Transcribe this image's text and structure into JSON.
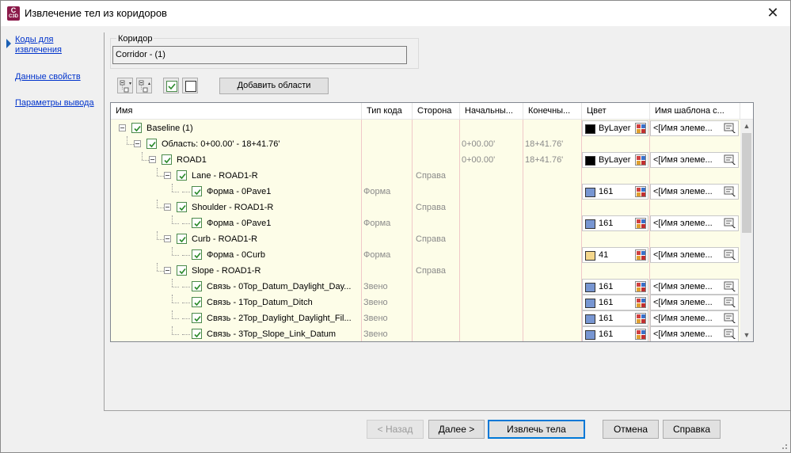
{
  "window": {
    "title": "Извлечение тел из коридоров",
    "icon_text": "C",
    "icon_sub": "C3D",
    "close_glyph": "✕"
  },
  "nav": {
    "items": [
      {
        "label": "Коды для извлечения"
      },
      {
        "label": "Данные свойств"
      },
      {
        "label": "Параметры вывода"
      }
    ]
  },
  "corridor": {
    "group_label": "Коридор",
    "value": "Corridor - (1)"
  },
  "toolbar": {
    "add_areas_label": "Добавить области"
  },
  "grid": {
    "columns": [
      "Имя",
      "Тип кода",
      "Сторона",
      "Начальны...",
      "Конечны...",
      "Цвет",
      "Имя шаблона с..."
    ],
    "rows": [
      {
        "name": "Baseline (1)",
        "code_type": "",
        "side": "",
        "start": "",
        "end": "",
        "color": "ByLayer",
        "color_hex": "#000000",
        "template": "<[Имя элеме..."
      },
      {
        "name": "Область: 0+00.00' - 18+41.76'",
        "code_type": "",
        "side": "",
        "start": "0+00.00'",
        "end": "18+41.76'",
        "color": "",
        "color_hex": "",
        "template": ""
      },
      {
        "name": "ROAD1",
        "code_type": "",
        "side": "",
        "start": "0+00.00'",
        "end": "18+41.76'",
        "color": "ByLayer",
        "color_hex": "#000000",
        "template": "<[Имя элеме..."
      },
      {
        "name": "Lane - ROAD1-R",
        "code_type": "",
        "side": "Справа",
        "start": "",
        "end": "",
        "color": "",
        "color_hex": "",
        "template": ""
      },
      {
        "name": "Форма - 0Pave1",
        "code_type": "Форма",
        "side": "",
        "start": "",
        "end": "",
        "color": "161",
        "color_hex": "#7896d2",
        "template": "<[Имя элеме..."
      },
      {
        "name": "Shoulder - ROAD1-R",
        "code_type": "",
        "side": "Справа",
        "start": "",
        "end": "",
        "color": "",
        "color_hex": "",
        "template": ""
      },
      {
        "name": "Форма - 0Pave1",
        "code_type": "Форма",
        "side": "",
        "start": "",
        "end": "",
        "color": "161",
        "color_hex": "#7896d2",
        "template": "<[Имя элеме..."
      },
      {
        "name": "Curb - ROAD1-R",
        "code_type": "",
        "side": "Справа",
        "start": "",
        "end": "",
        "color": "",
        "color_hex": "",
        "template": ""
      },
      {
        "name": "Форма - 0Curb",
        "code_type": "Форма",
        "side": "",
        "start": "",
        "end": "",
        "color": "41",
        "color_hex": "#f5d78c",
        "template": "<[Имя элеме..."
      },
      {
        "name": "Slope - ROAD1-R",
        "code_type": "",
        "side": "Справа",
        "start": "",
        "end": "",
        "color": "",
        "color_hex": "",
        "template": ""
      },
      {
        "name": "Связь - 0Top_Datum_Daylight_Day...",
        "code_type": "Звено",
        "side": "",
        "start": "",
        "end": "",
        "color": "161",
        "color_hex": "#7896d2",
        "template": "<[Имя элеме..."
      },
      {
        "name": "Связь - 1Top_Datum_Ditch",
        "code_type": "Звено",
        "side": "",
        "start": "",
        "end": "",
        "color": "161",
        "color_hex": "#7896d2",
        "template": "<[Имя элеме..."
      },
      {
        "name": "Связь - 2Top_Daylight_Daylight_Fil...",
        "code_type": "Звено",
        "side": "",
        "start": "",
        "end": "",
        "color": "161",
        "color_hex": "#7896d2",
        "template": "<[Имя элеме..."
      },
      {
        "name": "Связь - 3Top_Slope_Link_Datum",
        "code_type": "Звено",
        "side": "",
        "start": "",
        "end": "",
        "color": "161",
        "color_hex": "#7896d2",
        "template": "<[Имя элеме..."
      }
    ]
  },
  "buttons": {
    "back": "< Назад",
    "next": "Далее >",
    "extract": "Извлечь тела",
    "cancel": "Отмена",
    "help": "Справка"
  },
  "scrollbar": {
    "up": "▲",
    "down": "▼"
  }
}
